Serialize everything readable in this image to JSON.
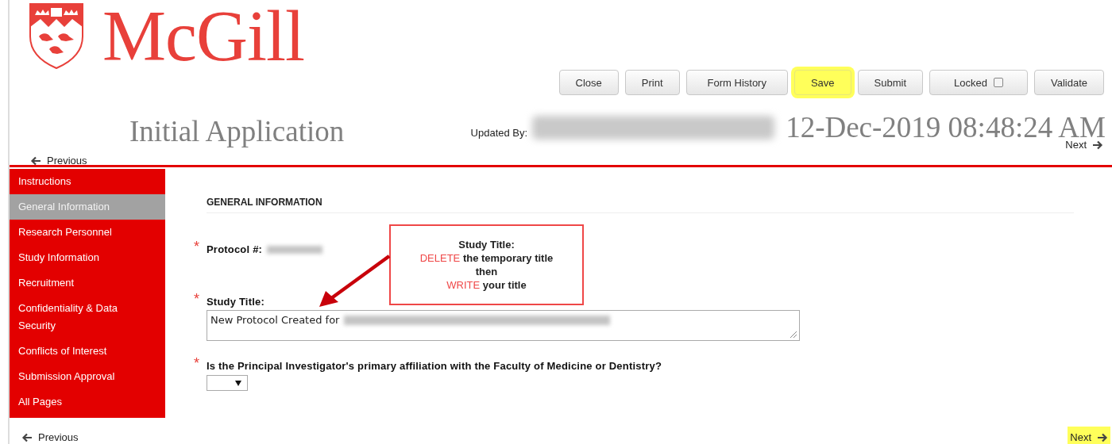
{
  "logo": {
    "name": "McGill"
  },
  "toolbar": {
    "buttons": [
      {
        "kind": "button",
        "label": "Close",
        "highlighted": false
      },
      {
        "kind": "button",
        "label": "Print",
        "highlighted": false
      },
      {
        "kind": "button",
        "label": "Form History",
        "highlighted": false
      },
      {
        "kind": "button",
        "label": "Save",
        "highlighted": true
      },
      {
        "kind": "button",
        "label": "Submit",
        "highlighted": false
      },
      {
        "kind": "checkbox",
        "label": "Locked",
        "checked": false,
        "highlighted": false
      },
      {
        "kind": "button",
        "label": "Validate",
        "highlighted": false
      }
    ]
  },
  "header": {
    "title": "Initial Application",
    "updated_by_label": "Updated By:",
    "updated_at": "12-Dec-2019 08:48:24 AM",
    "previous": {
      "label": "Previous",
      "highlighted": false
    },
    "next": {
      "label": "Next",
      "highlighted": false
    }
  },
  "sidebar": {
    "items": [
      {
        "label": "Instructions",
        "selected": false
      },
      {
        "label": "General Information",
        "selected": true
      },
      {
        "label": "Research Personnel",
        "selected": false
      },
      {
        "label": "Study Information",
        "selected": false
      },
      {
        "label": "Recruitment",
        "selected": false
      },
      {
        "label": "Confidentiality & Data Security",
        "selected": false
      },
      {
        "label": "Conflicts of Interest",
        "selected": false
      },
      {
        "label": "Submission Approval",
        "selected": false
      },
      {
        "label": "All Pages",
        "selected": false
      }
    ]
  },
  "form": {
    "section_title": "GENERAL INFORMATION",
    "fields": [
      {
        "kind": "readonly",
        "marker": "*",
        "label": "Protocol #:"
      },
      {
        "kind": "textarea",
        "marker": "*",
        "label": "Study Title:",
        "value": "New Protocol Created for"
      },
      {
        "kind": "select",
        "marker": "*",
        "label": "Is the Principal Investigator's primary affiliation with the Faculty of Medicine or Dentistry?"
      }
    ]
  },
  "callout": {
    "lines": [
      [
        {
          "text": "Study Title:",
          "emphasis": false
        }
      ],
      [
        {
          "text": "DELETE",
          "emphasis": true
        },
        {
          "text": " the temporary title",
          "emphasis": false
        }
      ],
      [
        {
          "text": "then",
          "emphasis": false
        }
      ],
      [
        {
          "text": "WRITE",
          "emphasis": true
        },
        {
          "text": " your title",
          "emphasis": false
        }
      ]
    ]
  },
  "footer_nav": {
    "previous": {
      "label": "Previous",
      "highlighted": false
    },
    "next": {
      "label": "Next",
      "highlighted": true
    }
  }
}
